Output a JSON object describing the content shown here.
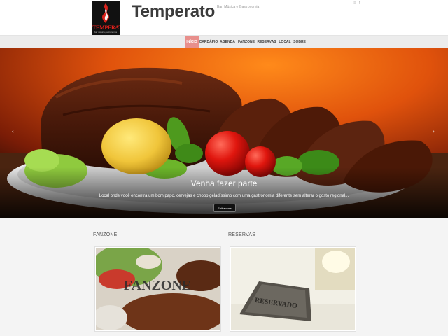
{
  "header": {
    "logo_text": "TEMPERATO",
    "logo_subtext": "bar música gastronomia",
    "site_title": "Temperato",
    "tagline": "Bar, Música e Gastronomia",
    "social_icons": [
      "rss-icon",
      "facebook-icon"
    ],
    "social_glyphs": {
      "rss": "૰",
      "facebook": "f"
    }
  },
  "nav": {
    "items": [
      "INÍCIO",
      "CARDÁPIO",
      "AGENDA",
      "FANZONE",
      "RESERVAS",
      "LOCAL",
      "SOBRE"
    ],
    "active_index": 0,
    "active_color": "#e88f8c"
  },
  "hero": {
    "title": "Venha fazer parte",
    "text": "Local onde você encontra um bom papo, cervejas e chopp geladíssimo com uma gastronomia diferente sem alterar o gosto regional...",
    "button_label": "Saiba mais",
    "prev_arrow": "‹",
    "next_arrow": "›"
  },
  "sections": [
    {
      "label": "FANZONE",
      "image_text": "FANZONE"
    },
    {
      "label": "RESERVAS",
      "image_text": "RESERVADO"
    }
  ]
}
